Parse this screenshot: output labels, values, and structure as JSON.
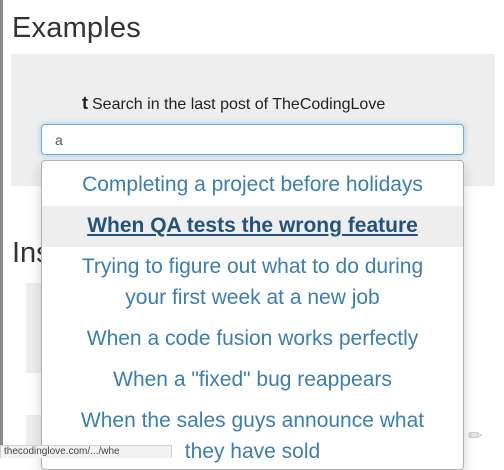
{
  "page": {
    "title": "Examples",
    "section_title": "Ins"
  },
  "search": {
    "icon": "tumblr-icon",
    "icon_glyph": "t",
    "heading": "Search in the last post of TheCodingLove",
    "value": "a"
  },
  "suggestions": [
    "Completing a project before holidays",
    "When QA tests the wrong feature",
    "Trying to figure out what to do during your first week at a new job",
    "When a code fusion works perfectly",
    "When a \"fixed\" bug reappears",
    "When the sales guys announce what they have sold"
  ],
  "active_suggestion_index": 1,
  "status_bar": {
    "url": "thecodinglove.com/.../whe"
  },
  "colors": {
    "link": "#3a7fb1",
    "link_active": "#23527c",
    "panel_bg": "#eeeeee",
    "focus_border": "#66afe9"
  }
}
